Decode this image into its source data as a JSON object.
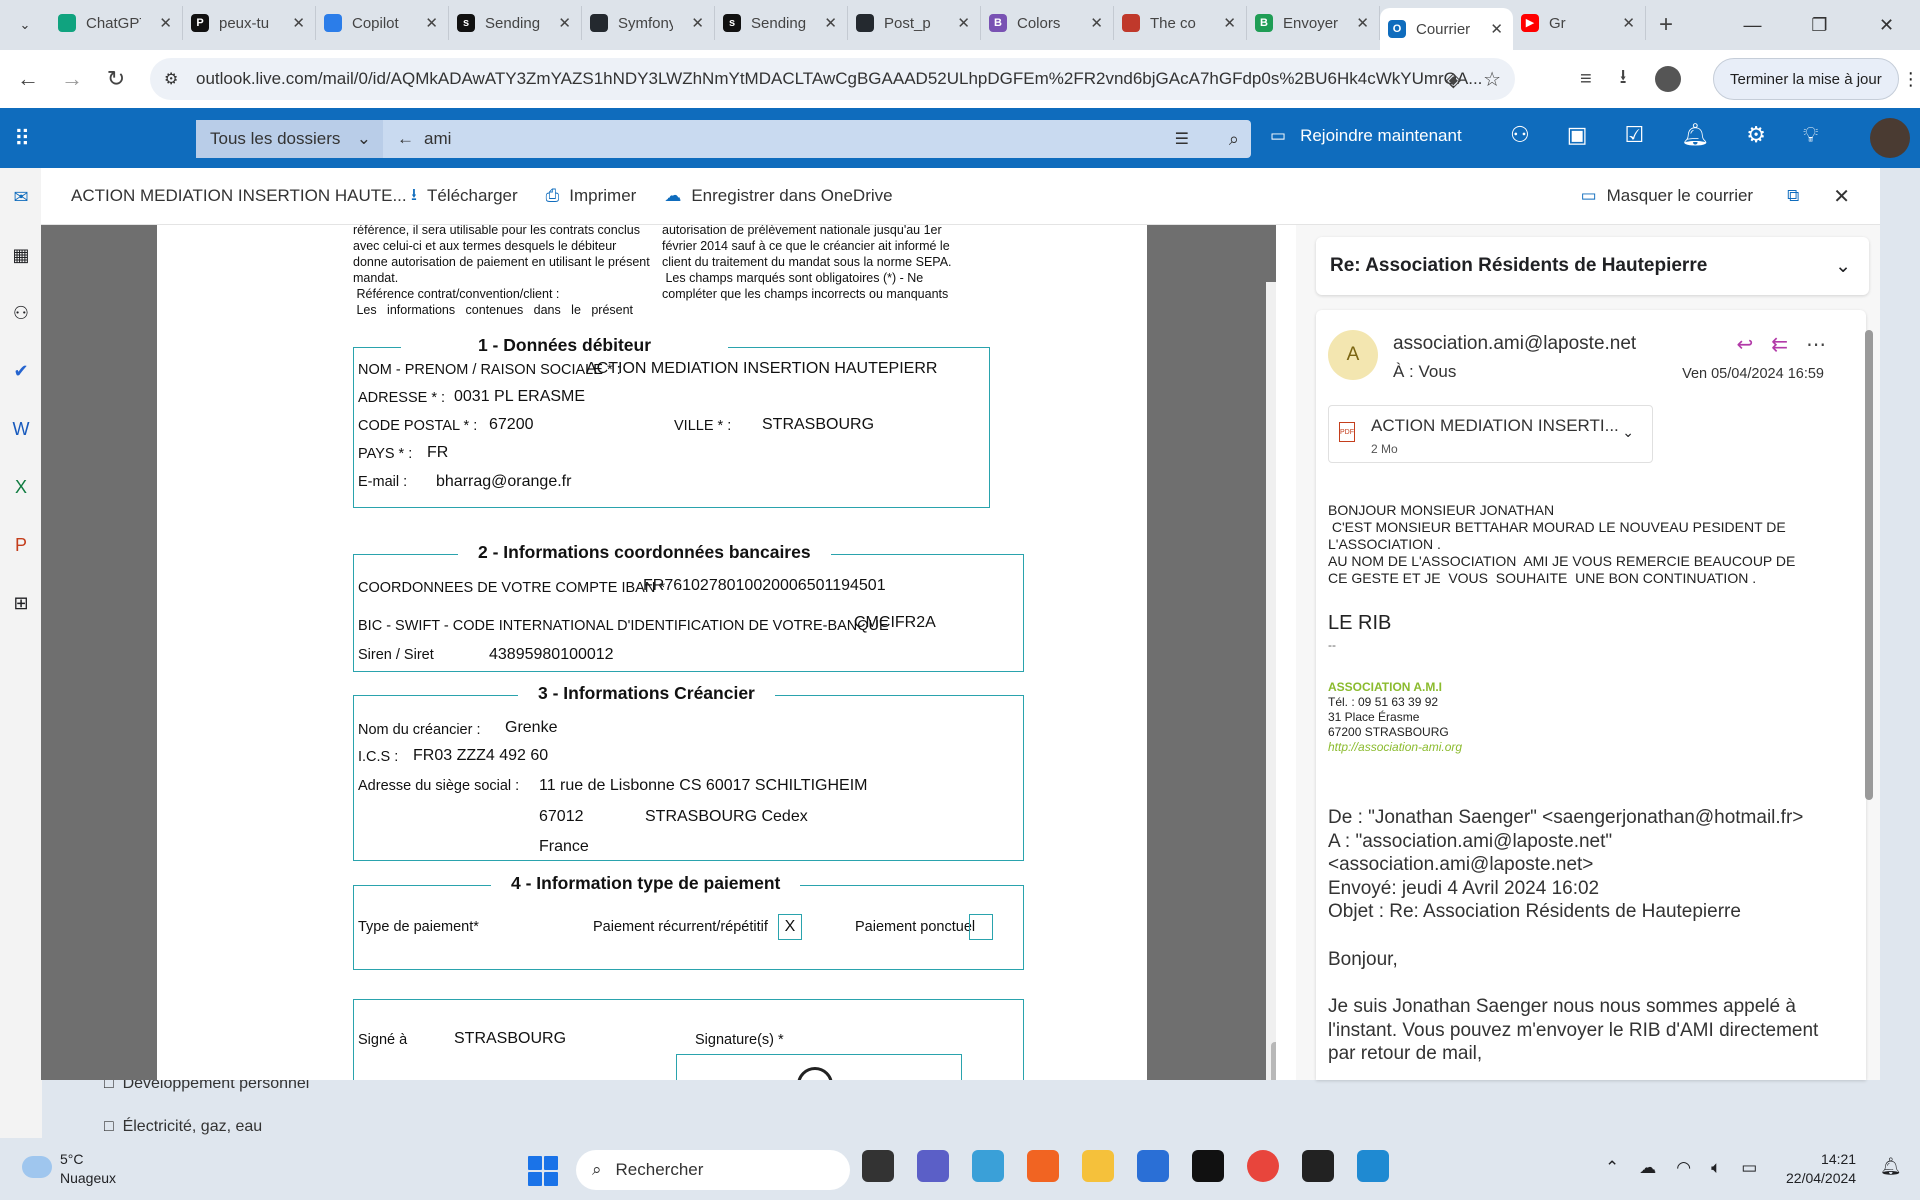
{
  "browser": {
    "tabs": [
      {
        "title": "ChatGPT",
        "color": "#10a37f",
        "glyph": ""
      },
      {
        "title": "peux-tu",
        "color": "#111111",
        "glyph": "P"
      },
      {
        "title": "Copilot",
        "color": "#2b7de9",
        "glyph": ""
      },
      {
        "title": "Sending",
        "color": "#111111",
        "glyph": "s"
      },
      {
        "title": "Symfony",
        "color": "#24292f",
        "glyph": ""
      },
      {
        "title": "Sending",
        "color": "#111111",
        "glyph": "s"
      },
      {
        "title": "Post_p",
        "color": "#24292f",
        "glyph": ""
      },
      {
        "title": "Colors",
        "color": "#7952b3",
        "glyph": "B"
      },
      {
        "title": "The co",
        "color": "#c0392b",
        "glyph": ""
      },
      {
        "title": "Envoyer",
        "color": "#1f9d55",
        "glyph": "B"
      },
      {
        "title": "Courrier",
        "color": "#0f6cbd",
        "glyph": "O"
      },
      {
        "title": "Gr",
        "color": "#ff0000",
        "glyph": "▶"
      }
    ],
    "url": "outlook.live.com/mail/0/id/AQMkADAwATY3ZmYAZS1hNDY3LWZhNmYtMDACLTAwCgBGAAAD52ULhpDGFEm%2FR2vnd6bjGAcA7hGFdp0s%2BU6Hk4cWkYUmrQA...",
    "update_label": "Terminer la mise à jour"
  },
  "outlook": {
    "folder_select": "Tous les dossiers",
    "search_query": "ami",
    "join_label": "Rejoindre maintenant",
    "bg_folders": [
      "Développement personnel",
      "Électricité, gaz, eau"
    ]
  },
  "viewer": {
    "doc_name": "ACTION MEDIATION INSERTION HAUTE...",
    "download": "Télécharger",
    "print": "Imprimer",
    "onedrive": "Enregistrer dans OneDrive",
    "hide_mail": "Masquer le courrier"
  },
  "pdf": {
    "top_left": [
      "référence, il sera utilisable pour les contrats conclus",
      "avec celui-ci et aux termes desquels le débiteur",
      "donne autorisation de paiement en utilisant le présent",
      "mandat.",
      " Référence contrat/convention/client :",
      " Les   informations   contenues   dans   le   présent"
    ],
    "top_right": [
      "autorisation de prélèvement nationale jusqu'au 1er",
      "février 2014 sauf à ce que le créancier ait informé le",
      "client du traitement du mandat sous la norme SEPA.",
      " Les champs marqués sont obligatoires (*) - Ne",
      "compléter que les champs incorrects ou manquants"
    ],
    "s1": {
      "title": "1 - Données débiteur",
      "name_label": "NOM - PRENOM / RAISON SOCIALE * :",
      "name_value": "ACTION MEDIATION INSERTION HAUTEPIERR",
      "address_label": "ADRESSE * :",
      "address_value": "0031 PL ERASME",
      "cp_label": "CODE POSTAL * :",
      "cp_value": "67200",
      "city_label": "VILLE * :",
      "city_value": "STRASBOURG",
      "country_label": "PAYS * :",
      "country_value": "FR",
      "email_label": "E-mail :",
      "email_value": "bharrag@orange.fr"
    },
    "s2": {
      "title": "2 - Informations coordonnées bancaires",
      "iban_label": "COORDONNEES DE VOTRE COMPTE IBAN *",
      "iban_value": "FR7610278010020006501194501",
      "bic_label": "BIC - SWIFT - CODE INTERNATIONAL D'IDENTIFICATION DE VOTRE-BANQUE",
      "bic_value": "CMCIFR2A",
      "siren_label": "Siren / Siret",
      "siren_value": "43895980100012"
    },
    "s3": {
      "title": "3 - Informations Créancier",
      "creditor_label": "Nom du créancier :",
      "creditor_value": "Grenke",
      "ics_label": "I.C.S :",
      "ics_value": "FR03 ZZZ4 492 60",
      "hq_label": "Adresse du siège social :",
      "hq_street": "11 rue de Lisbonne CS 60017 SCHILTIGHEIM",
      "hq_cp": "67012",
      "hq_city": "STRASBOURG Cedex",
      "hq_country": "France"
    },
    "s4": {
      "title": "4 - Information type de paiement",
      "type_label": "Type de paiement*",
      "recurring_label": "Paiement récurrent/répétitif",
      "recurring_mark": "X",
      "oneoff_label": "Paiement ponctuel"
    },
    "s5": {
      "signed_label": "Signé  à",
      "signed_value": "STRASBOURG",
      "signature_label": "Signature(s) *"
    }
  },
  "mail": {
    "subject": "Re: Association Résidents de Hautepierre",
    "sender_initial": "A",
    "sender": "association.ami@laposte.net",
    "to": "À :  Vous",
    "date": "Ven 05/04/2024 16:59",
    "attachment_name": "ACTION MEDIATION INSERTI...",
    "attachment_size": "2 Mo",
    "body": "BONJOUR MONSIEUR JONATHAN\n C'EST MONSIEUR BETTAHAR MOURAD LE NOUVEAU PESIDENT DE\nL'ASSOCIATION .\nAU NOM DE L'ASSOCIATION  AMI JE VOUS REMERCIE BEAUCOUP DE\nCE GESTE ET JE  VOUS  SOUHAITE  UNE BON CONTINUATION .",
    "rib": "LE RIB",
    "dash": "--",
    "sig_name": "ASSOCIATION A.M.I",
    "sig_tel": "Tél. : 09 51 63 39 92",
    "sig_addr": "31 Place Érasme",
    "sig_city": "67200 STRASBOURG",
    "sig_url": "http://association-ami.org",
    "q_from": "De : \"Jonathan Saenger\" <saengerjonathan@hotmail.fr>",
    "q_to": "A : \"association.ami@laposte.net\"",
    "q_to2": "<association.ami@laposte.net>",
    "q_sent": "Envoyé: jeudi 4 Avril 2024 16:02",
    "q_subject": "Objet : Re: Association Résidents de Hautepierre",
    "q_hello": "Bonjour,",
    "q_text": "Je suis Jonathan Saenger nous nous sommes appelé à l'instant. Vous pouvez m'envoyer le RIB d'AMI directement par retour de mail,"
  },
  "taskbar": {
    "temp": "5°C",
    "weather": "Nuageux",
    "search": "Rechercher",
    "time": "14:21",
    "date": "22/04/2024"
  }
}
